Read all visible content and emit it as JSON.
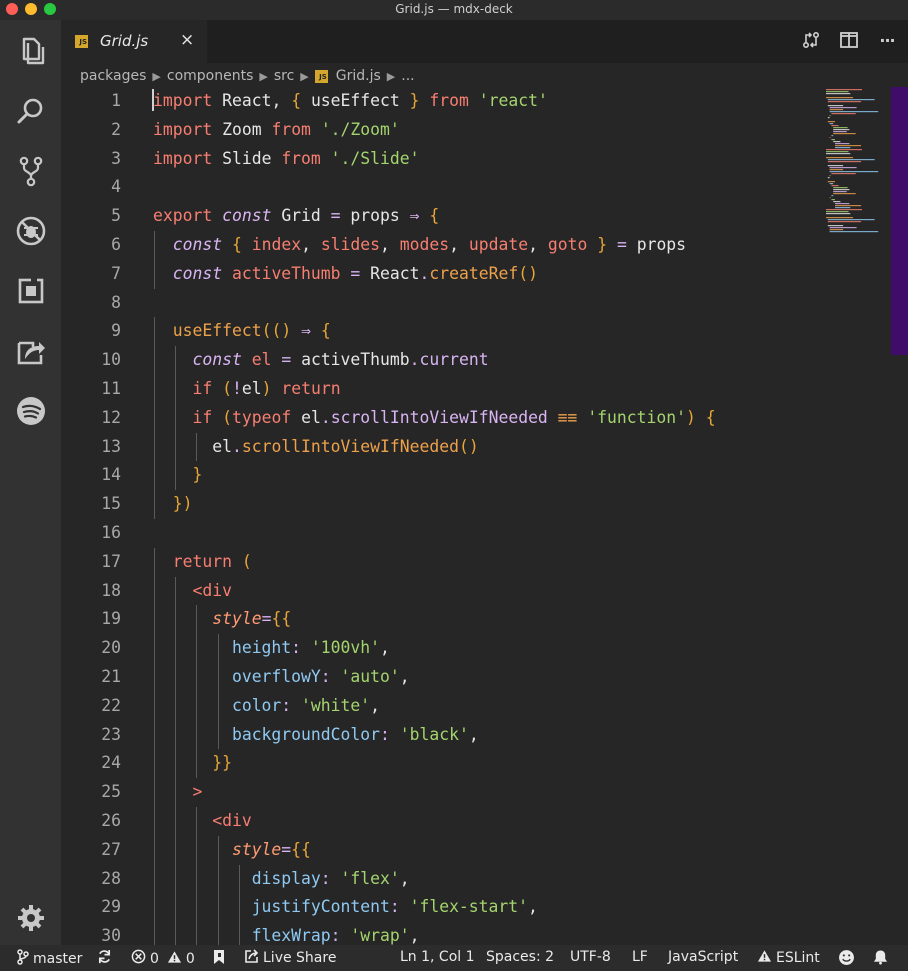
{
  "window": {
    "title": "Grid.js — mdx-deck"
  },
  "activity": {
    "items": [
      {
        "name": "explorer-icon"
      },
      {
        "name": "search-icon"
      },
      {
        "name": "source-control-icon"
      },
      {
        "name": "debug-icon"
      },
      {
        "name": "extensions-icon"
      },
      {
        "name": "remote-icon"
      },
      {
        "name": "spotify-icon"
      },
      {
        "name": "settings-gear-icon"
      }
    ]
  },
  "tab": {
    "badge": "JS",
    "label": "Grid.js",
    "close": "×"
  },
  "toolbar": {
    "more": "···"
  },
  "breadcrumb": {
    "items": [
      "packages",
      "components",
      "src",
      "Grid.js",
      "..."
    ],
    "badge": "JS"
  },
  "code": {
    "lines": [
      "import React, { useEffect } from 'react'",
      "import Zoom from './Zoom'",
      "import Slide from './Slide'",
      "",
      "export const Grid = props => {",
      "  const { index, slides, modes, update, goto } = props",
      "  const activeThumb = React.createRef()",
      "",
      "  useEffect(() => {",
      "    const el = activeThumb.current",
      "    if (!el) return",
      "    if (typeof el.scrollIntoViewIfNeeded === 'function') {",
      "      el.scrollIntoViewIfNeeded()",
      "    }",
      "  })",
      "",
      "  return (",
      "    <div",
      "      style={{",
      "        height: '100vh',",
      "        overflowY: 'auto',",
      "        color: 'white',",
      "        backgroundColor: 'black',",
      "      }}",
      "    >",
      "      <div",
      "        style={{",
      "          display: 'flex',",
      "          justifyContent: 'flex-start',",
      "          flexWrap: 'wrap',"
    ]
  },
  "status": {
    "branch": "master",
    "errors": "0",
    "warnings": "0",
    "live_share": "Live Share",
    "position": "Ln 1, Col 1",
    "spaces": "Spaces: 2",
    "encoding": "UTF-8",
    "eol": "LF",
    "language": "JavaScript",
    "linter": "ESLint"
  },
  "colors": {
    "keyword": "#f77e71",
    "string": "#a3d46e",
    "function": "#eda14b",
    "variable": "#d9b4f2",
    "property": "#8fc9f2",
    "scrollbar": "#3f0d69",
    "editor_bg": "#262626"
  }
}
